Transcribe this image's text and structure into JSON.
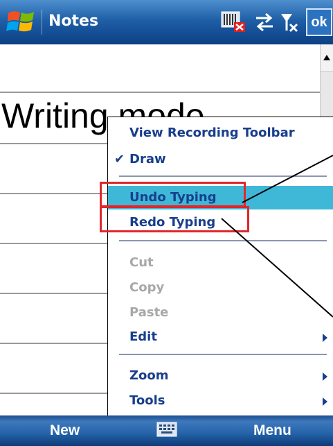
{
  "titlebar": {
    "app_title": "Notes",
    "ok_label": "ok"
  },
  "note": {
    "heading": "Writing mode"
  },
  "menu": {
    "items": [
      {
        "label": "View Recording Toolbar",
        "state": "enabled"
      },
      {
        "label": "Draw",
        "state": "checked"
      },
      {
        "label": "Undo Typing",
        "state": "highlighted"
      },
      {
        "label": "Redo Typing",
        "state": "enabled"
      },
      {
        "label": "Cut",
        "state": "disabled"
      },
      {
        "label": "Copy",
        "state": "disabled"
      },
      {
        "label": "Paste",
        "state": "disabled"
      },
      {
        "label": "Edit",
        "state": "submenu"
      },
      {
        "label": "Zoom",
        "state": "submenu"
      },
      {
        "label": "Tools",
        "state": "submenu"
      }
    ]
  },
  "softkeys": {
    "left": "New",
    "right": "Menu"
  },
  "colors": {
    "menu_text": "#183e8c",
    "menu_highlight": "#3fb8d8",
    "callout_red": "#e2262b",
    "title_bar": "#1f5fa6"
  },
  "icons": [
    "windows-start-icon",
    "keyboard-mute-icon",
    "sync-arrows-icon",
    "signal-off-icon",
    "speaker-icon",
    "sip-keyboard-icon"
  ]
}
